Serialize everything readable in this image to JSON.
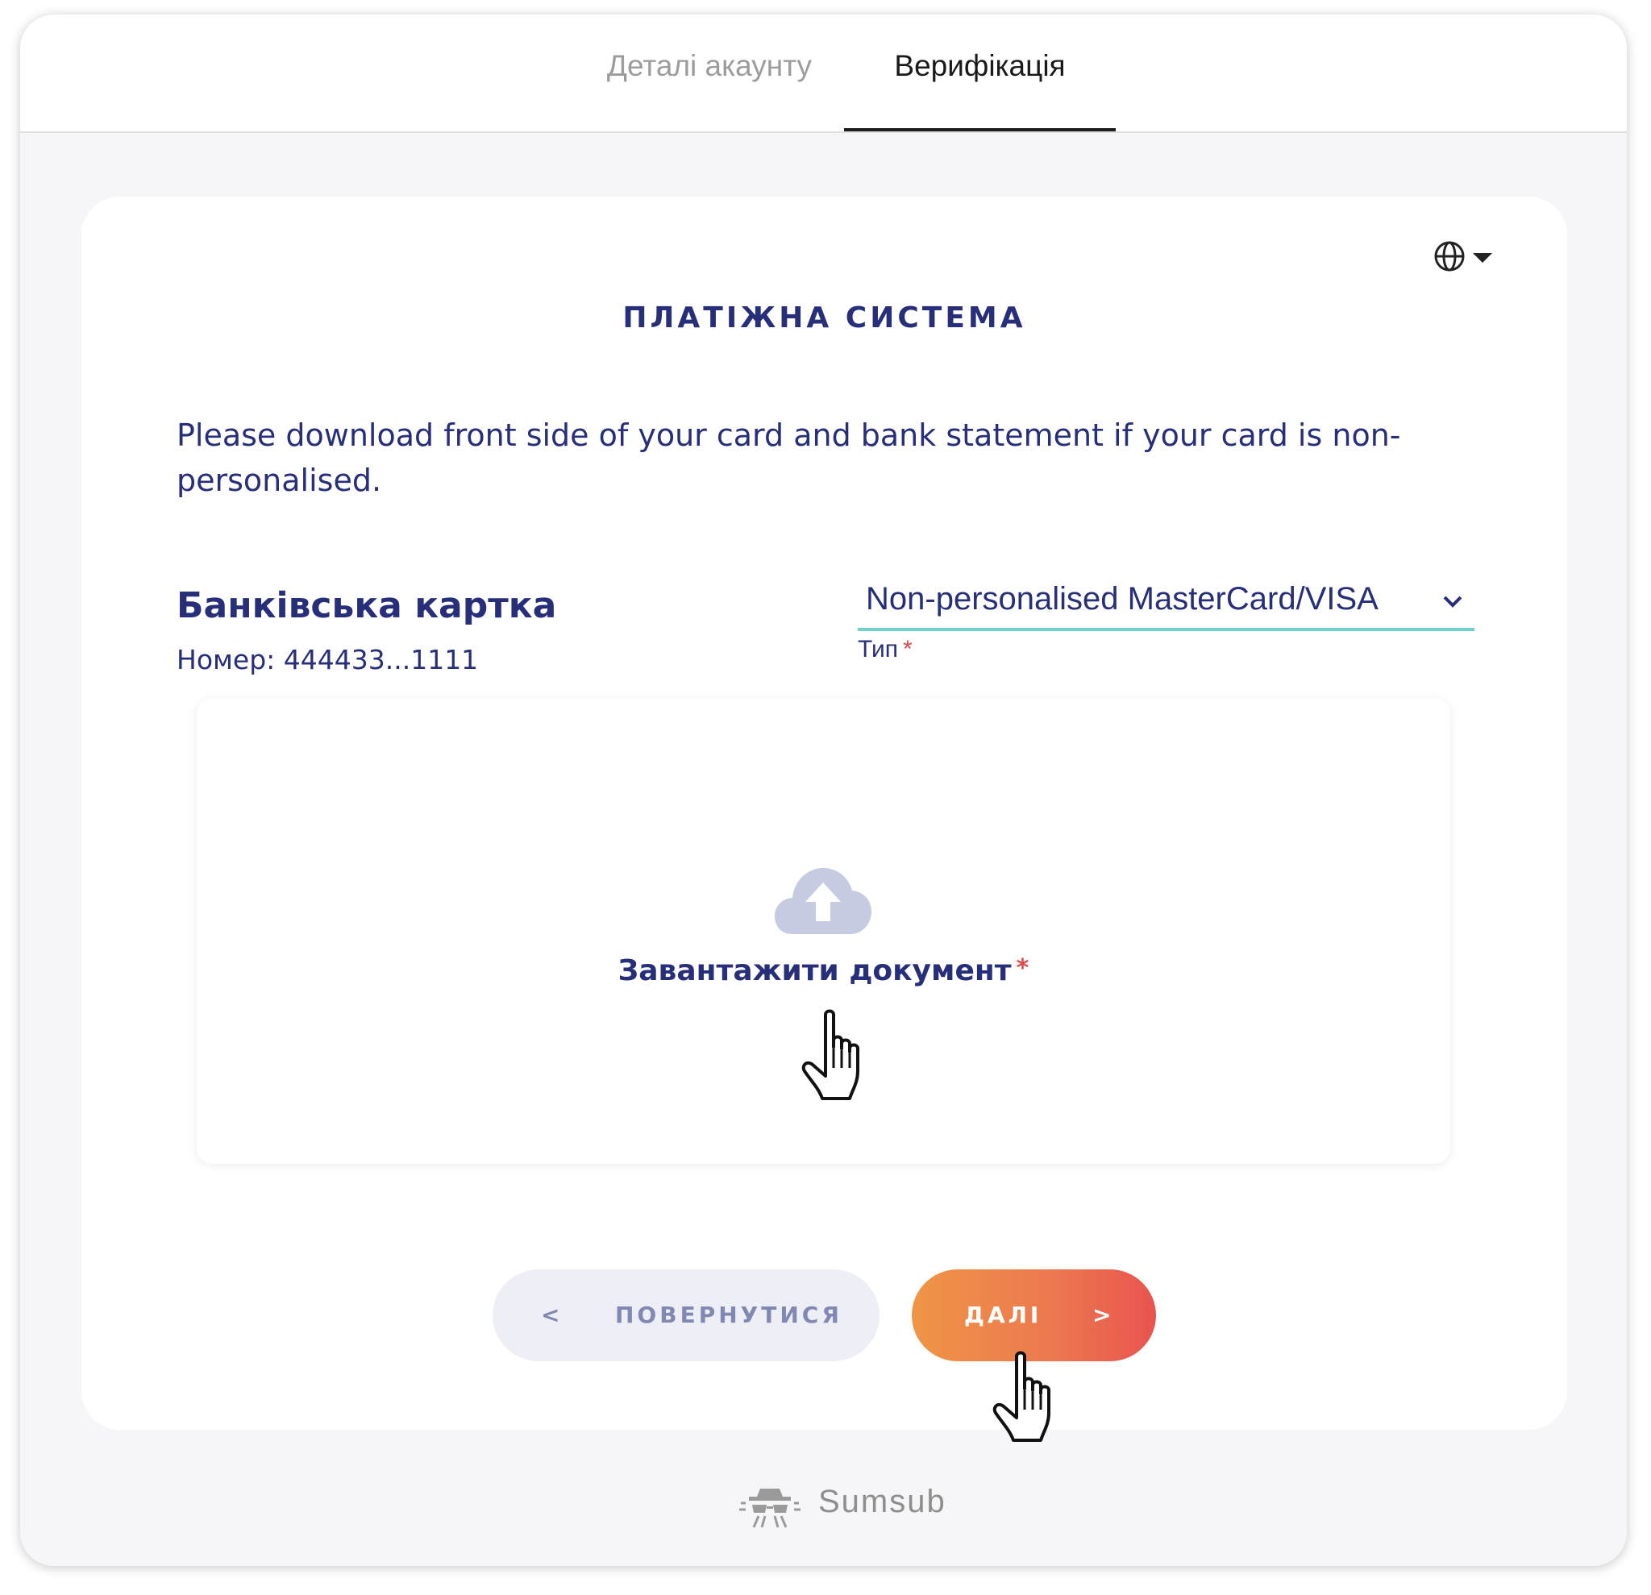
{
  "tabs": [
    {
      "label": "Деталі акаунту",
      "active": false
    },
    {
      "label": "Верифікація",
      "active": true
    }
  ],
  "card": {
    "language_icon": "globe-icon",
    "section_title": "ПЛАТІЖНА СИСТЕМА",
    "instruction": "Please download front side of your card and bank statement if your card is non-personalised.",
    "bank_card": {
      "title": "Банківська картка",
      "number": "Номер: 444433...1111"
    },
    "type_select": {
      "value": "Non-personalised MasterCard/VISA",
      "label": "Тип",
      "required_mark": "*"
    },
    "upload": {
      "icon": "cloud-upload-icon",
      "label": "Завантажити документ",
      "required_mark": "*"
    },
    "buttons": {
      "back_arrow": "<",
      "back_label": "ПОВЕРНУТИСЯ",
      "next_label": "ДАЛІ",
      "next_arrow": ">"
    }
  },
  "footer": {
    "brand": "Sumsub"
  },
  "colors": {
    "primary_text": "#272e7a",
    "accent_underline": "#6fd3cb",
    "required": "#e0474a",
    "next_gradient_start": "#ef9545",
    "next_gradient_end": "#e8544f",
    "back_bg": "#eeeff6"
  }
}
